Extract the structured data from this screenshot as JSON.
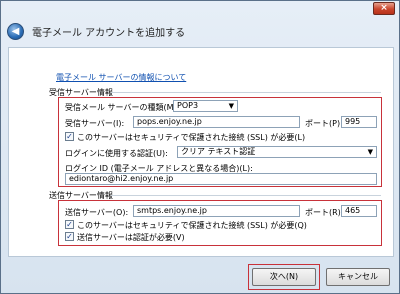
{
  "window": {
    "close_glyph": "×",
    "title": "電子メール アカウントを追加する",
    "back_glyph": "◀"
  },
  "link": "電子メール サーバーの情報について",
  "incoming": {
    "section_label": "受信サーバー情報",
    "server_type_label": "受信メール サーバーの種類(M)",
    "server_type_value": "POP3",
    "server_label": "受信サーバー(I):",
    "server_value": "pops.enjoy.ne.jp",
    "port_label": "ポート(P):",
    "port_value": "995",
    "ssl_label": "このサーバーはセキュリティで保護された接続 (SSL) が必要(L)",
    "ssl_checked": true,
    "auth_label": "ログインに使用する認証(U):",
    "auth_value": "クリア テキスト認証",
    "login_id_label": "ログイン ID (電子メール アドレスと異なる場合)(L):",
    "login_id_value": "ediontaro@hi2.enjoy.ne.jp"
  },
  "outgoing": {
    "section_label": "送信サーバー情報",
    "server_label": "送信サーバー(O):",
    "server_value": "smtps.enjoy.ne.jp",
    "port_label": "ポート(R):",
    "port_value": "465",
    "ssl_label": "このサーバーはセキュリティで保護された接続 (SSL) が必要(Q)",
    "ssl_checked": true,
    "auth_label": "送信サーバーは認証が必要(V)",
    "auth_checked": true
  },
  "buttons": {
    "next": "次へ(N)",
    "cancel": "キャンセル"
  },
  "colors": {
    "highlight": "#c8323a",
    "link": "#1050b0"
  }
}
